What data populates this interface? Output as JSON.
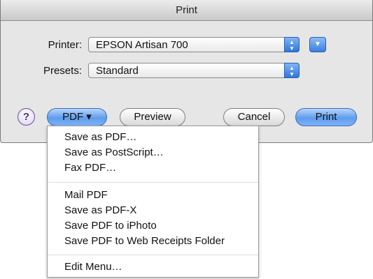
{
  "window": {
    "title": "Print"
  },
  "printer": {
    "label": "Printer:",
    "value": "EPSON Artisan 700"
  },
  "presets": {
    "label": "Presets:",
    "value": "Standard"
  },
  "buttons": {
    "help": "?",
    "pdf": "PDF ▾",
    "preview": "Preview",
    "cancel": "Cancel",
    "print": "Print"
  },
  "icons": {
    "popup_arrows": "up-down-arrows-icon",
    "disclosure": "disclosure-triangle-icon"
  },
  "pdf_menu": {
    "group1": [
      "Save as PDF…",
      "Save as PostScript…",
      "Fax PDF…"
    ],
    "group2": [
      "Mail PDF",
      "Save as PDF-X",
      "Save PDF to iPhoto",
      "Save PDF to Web Receipts Folder"
    ],
    "group3": [
      "Edit Menu…"
    ]
  }
}
